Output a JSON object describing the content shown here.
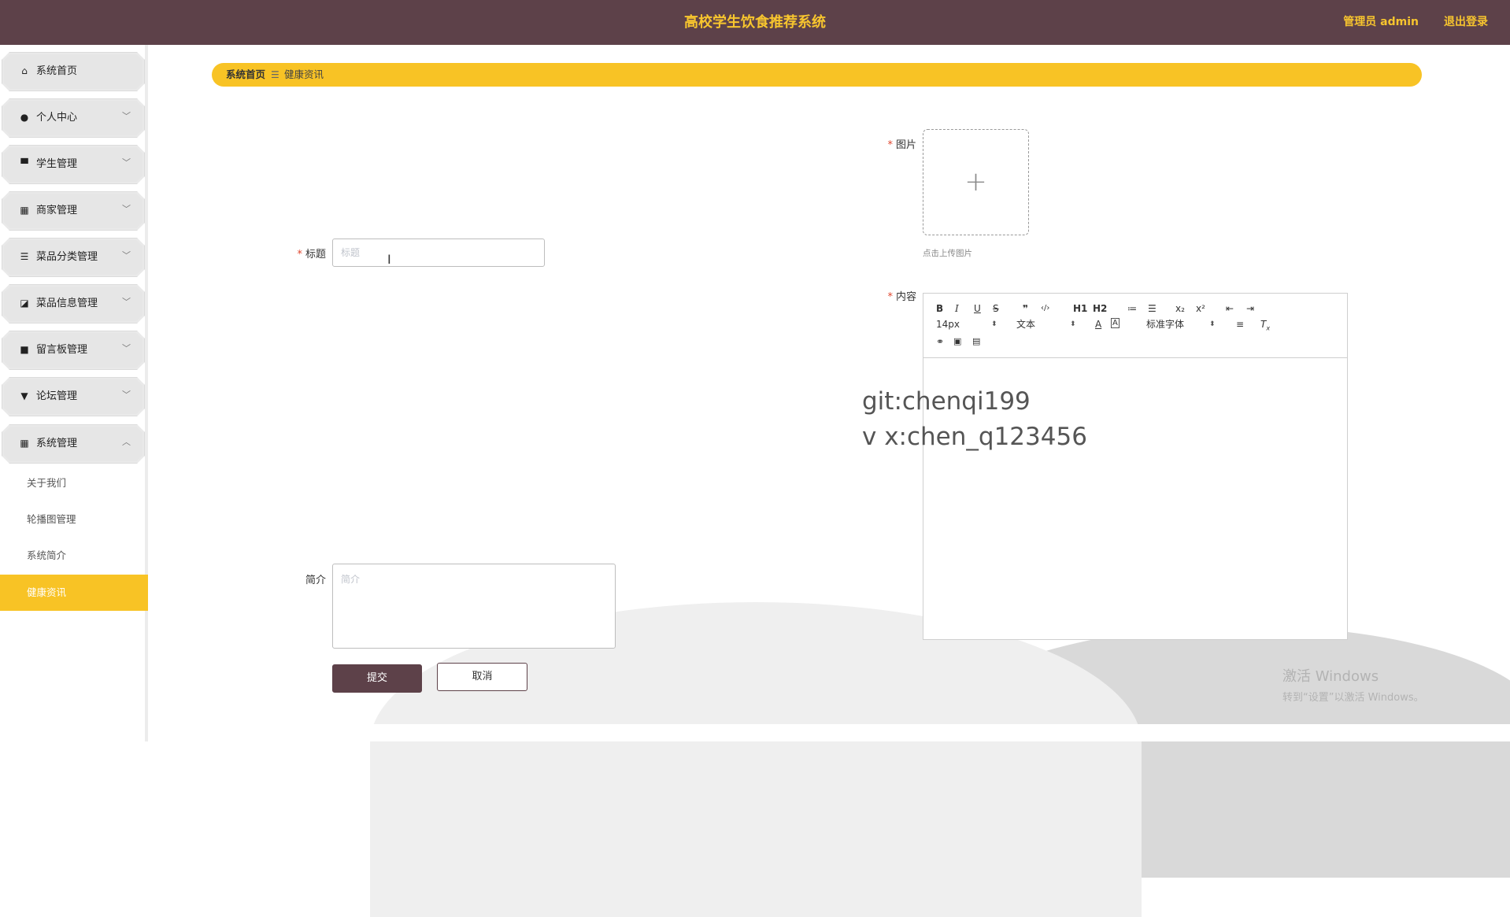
{
  "header": {
    "title": "高校学生饮食推荐系统",
    "admin": "管理员 admin",
    "logout": "退出登录"
  },
  "sidebar": {
    "items": [
      {
        "label": "系统首页",
        "icon": "home-icon",
        "glyph": "⌂"
      },
      {
        "label": "个人中心",
        "icon": "user-icon",
        "glyph": "●",
        "arrow": "﹀"
      },
      {
        "label": "学生管理",
        "icon": "monitor-icon",
        "glyph": "▀",
        "arrow": "﹀"
      },
      {
        "label": "商家管理",
        "icon": "grid-icon",
        "glyph": "▦",
        "arrow": "﹀"
      },
      {
        "label": "菜品分类管理",
        "icon": "list-icon",
        "glyph": "☰",
        "arrow": "﹀"
      },
      {
        "label": "菜品信息管理",
        "icon": "chart-icon",
        "glyph": "◪",
        "arrow": "﹀"
      },
      {
        "label": "留言板管理",
        "icon": "video-icon",
        "glyph": "■",
        "arrow": "﹀"
      },
      {
        "label": "论坛管理",
        "icon": "forum-icon",
        "glyph": "▼",
        "arrow": "﹀"
      },
      {
        "label": "系统管理",
        "icon": "grid-icon",
        "glyph": "▦",
        "arrow": "︿"
      }
    ],
    "subitems": [
      "关于我们",
      "轮播图管理",
      "系统简介",
      "健康资讯"
    ]
  },
  "breadcrumb": {
    "home": "系统首页",
    "sep": "☰",
    "current": "健康资讯"
  },
  "form": {
    "title_label": "标题",
    "title_placeholder": "标题",
    "image_label": "图片",
    "upload_hint": "点击上传图片",
    "content_label": "内容",
    "intro_label": "简介",
    "intro_placeholder": "简介",
    "submit": "提交",
    "cancel": "取消",
    "required_mark": "*"
  },
  "editor": {
    "font_size": "14px",
    "text_type": "文本",
    "font_family": "标准字体",
    "buttons": [
      "B",
      "I",
      "U",
      "S",
      "❞",
      "‹/›",
      "H1",
      "H2",
      "≔",
      "☰",
      "x₂",
      "x²",
      "⇤",
      "⇥"
    ]
  },
  "watermark": {
    "line1": "git:chenqi199",
    "line2": "v x:chen_q123456"
  },
  "windows_activation": {
    "line1": "激活 Windows",
    "line2": "转到“设置”以激活 Windows。"
  }
}
